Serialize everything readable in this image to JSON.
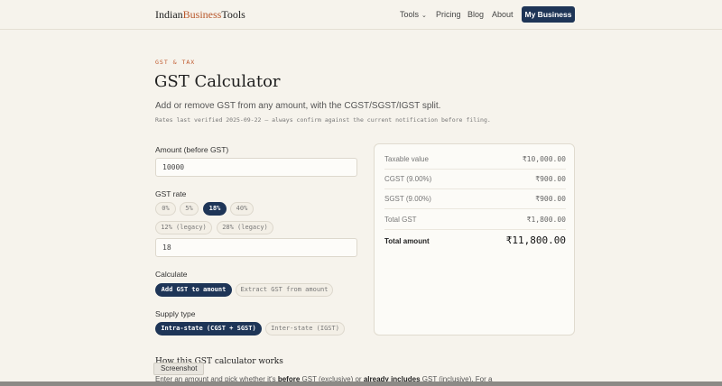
{
  "header": {
    "logo_part1": "Indian",
    "logo_part2": "Business",
    "logo_part3": "Tools",
    "nav": {
      "tools": "Tools",
      "pricing": "Pricing",
      "blog": "Blog",
      "about": "About"
    },
    "cta": "My Business"
  },
  "hero": {
    "eyebrow": "GST & TAX",
    "title": "GST Calculator",
    "subtitle": "Add or remove GST from any amount, with the CGST/SGST/IGST split.",
    "verified_note": "Rates last verified 2025-09-22 — always confirm against the current notification before filing."
  },
  "form": {
    "amount_label": "Amount (before GST)",
    "amount_value": "10000",
    "rate_label": "GST rate",
    "rates": [
      "0%",
      "5%",
      "18%",
      "40%",
      "12% (legacy)",
      "28% (legacy)"
    ],
    "selected_rate": "18%",
    "rate_value": "18",
    "calculate_label": "Calculate",
    "calculate_options": [
      "Add GST to amount",
      "Extract GST from amount"
    ],
    "selected_calculate": "Add GST to amount",
    "supply_label": "Supply type",
    "supply_options": [
      "Intra-state (CGST + SGST)",
      "Inter-state (IGST)"
    ],
    "selected_supply": "Intra-state (CGST + SGST)"
  },
  "results": [
    {
      "label": "Taxable value",
      "value": "₹10,000.00"
    },
    {
      "label": "CGST (9.00%)",
      "value": "₹900.00"
    },
    {
      "label": "SGST (9.00%)",
      "value": "₹900.00"
    },
    {
      "label": "Total GST",
      "value": "₹1,800.00"
    },
    {
      "label": "Total amount",
      "value": "₹11,800.00"
    }
  ],
  "howto": {
    "heading": "How this GST calculator works",
    "para_a": "Enter an amount and pick whether it's ",
    "para_b": "before",
    "para_c": " GST (exclusive) or ",
    "para_d": "already includes",
    "para_e": " GST (inclusive). For a"
  },
  "tooltip": "Screenshot",
  "colors": {
    "background": "#f6f3ec",
    "accent": "#c05a2e",
    "primary": "#1e3557"
  }
}
